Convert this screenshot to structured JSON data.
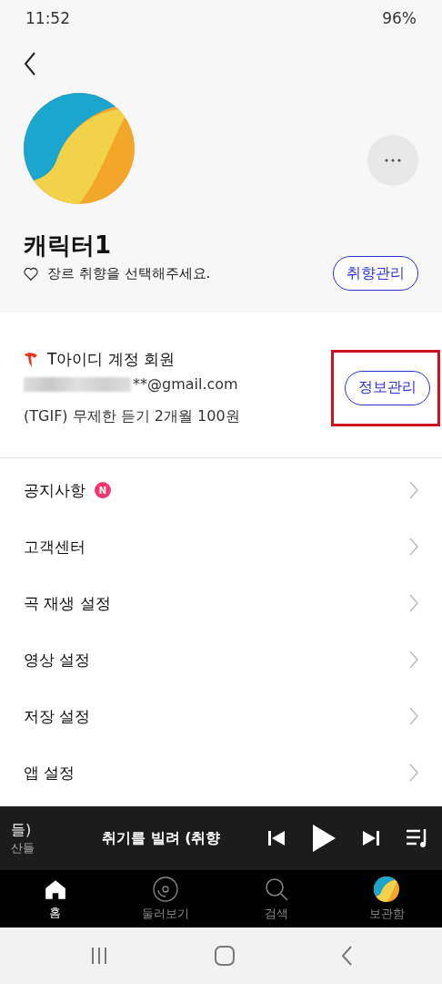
{
  "status_bar": {
    "time": "11:52",
    "battery": "96%"
  },
  "profile": {
    "name": "캐릭터1",
    "genre_hint": "장르 취향을 선택해주세요.",
    "genre_button": "취향관리"
  },
  "account": {
    "title": "T아이디 계정 회원",
    "email": "**@gmail.com",
    "plan": "(TGIF) 무제한 듣기 2개월 100원",
    "button": "정보관리",
    "highlighted": true
  },
  "menu": [
    {
      "label": "공지사항",
      "badge": "N"
    },
    {
      "label": "고객센터"
    },
    {
      "label": "곡 재생 설정"
    },
    {
      "label": "영상 설정"
    },
    {
      "label": "저장 설정"
    },
    {
      "label": "앱 설정"
    }
  ],
  "player": {
    "title_tail": "들)",
    "artist_tail": "산들",
    "next_title": "취기를 빌려 (취향"
  },
  "tabs": [
    {
      "label": "홈",
      "kind": "home",
      "selected": true
    },
    {
      "label": "둘러보기",
      "kind": "browse",
      "selected": false
    },
    {
      "label": "검색",
      "kind": "search",
      "selected": false
    },
    {
      "label": "보관함",
      "kind": "library",
      "selected": false
    }
  ]
}
